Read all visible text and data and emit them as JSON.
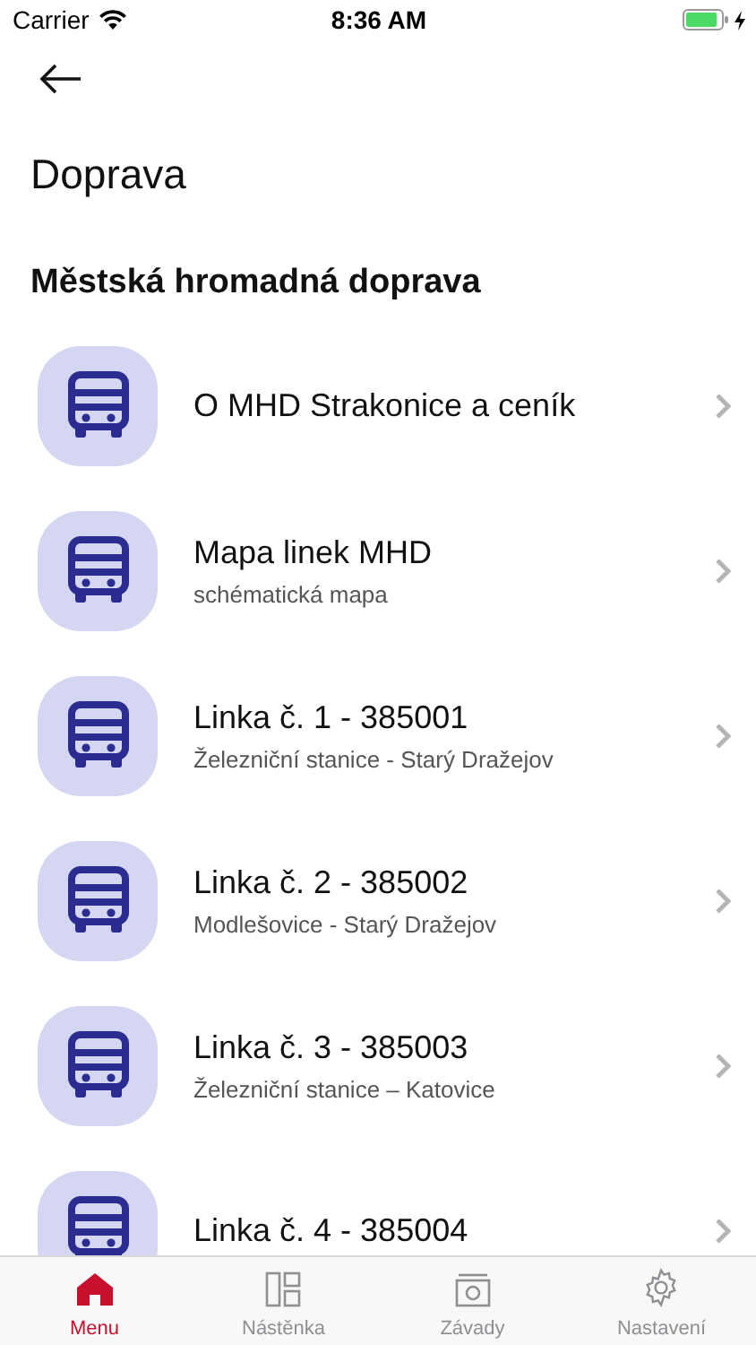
{
  "status_bar": {
    "carrier": "Carrier",
    "time": "8:36 AM"
  },
  "page_title": "Doprava",
  "section_title": "Městská hromadná doprava",
  "items": [
    {
      "title": "O MHD Strakonice a ceník"
    },
    {
      "title": "Mapa linek MHD",
      "subtitle": "schématická mapa"
    },
    {
      "title": "Linka č. 1 - 385001",
      "subtitle": "Železniční stanice - Starý Dražejov"
    },
    {
      "title": "Linka č. 2 - 385002",
      "subtitle": "Modlešovice - Starý Dražejov"
    },
    {
      "title": "Linka č. 3 - 385003",
      "subtitle": "Železniční stanice – Katovice"
    },
    {
      "title": "Linka č. 4 - 385004"
    }
  ],
  "tabs": [
    {
      "kind": "home",
      "label": "Menu",
      "selected": true
    },
    {
      "kind": "board",
      "label": "Nástěnka",
      "selected": false
    },
    {
      "kind": "camera",
      "label": "Závady",
      "selected": false
    },
    {
      "kind": "gear",
      "label": "Nastavení",
      "selected": false
    }
  ]
}
